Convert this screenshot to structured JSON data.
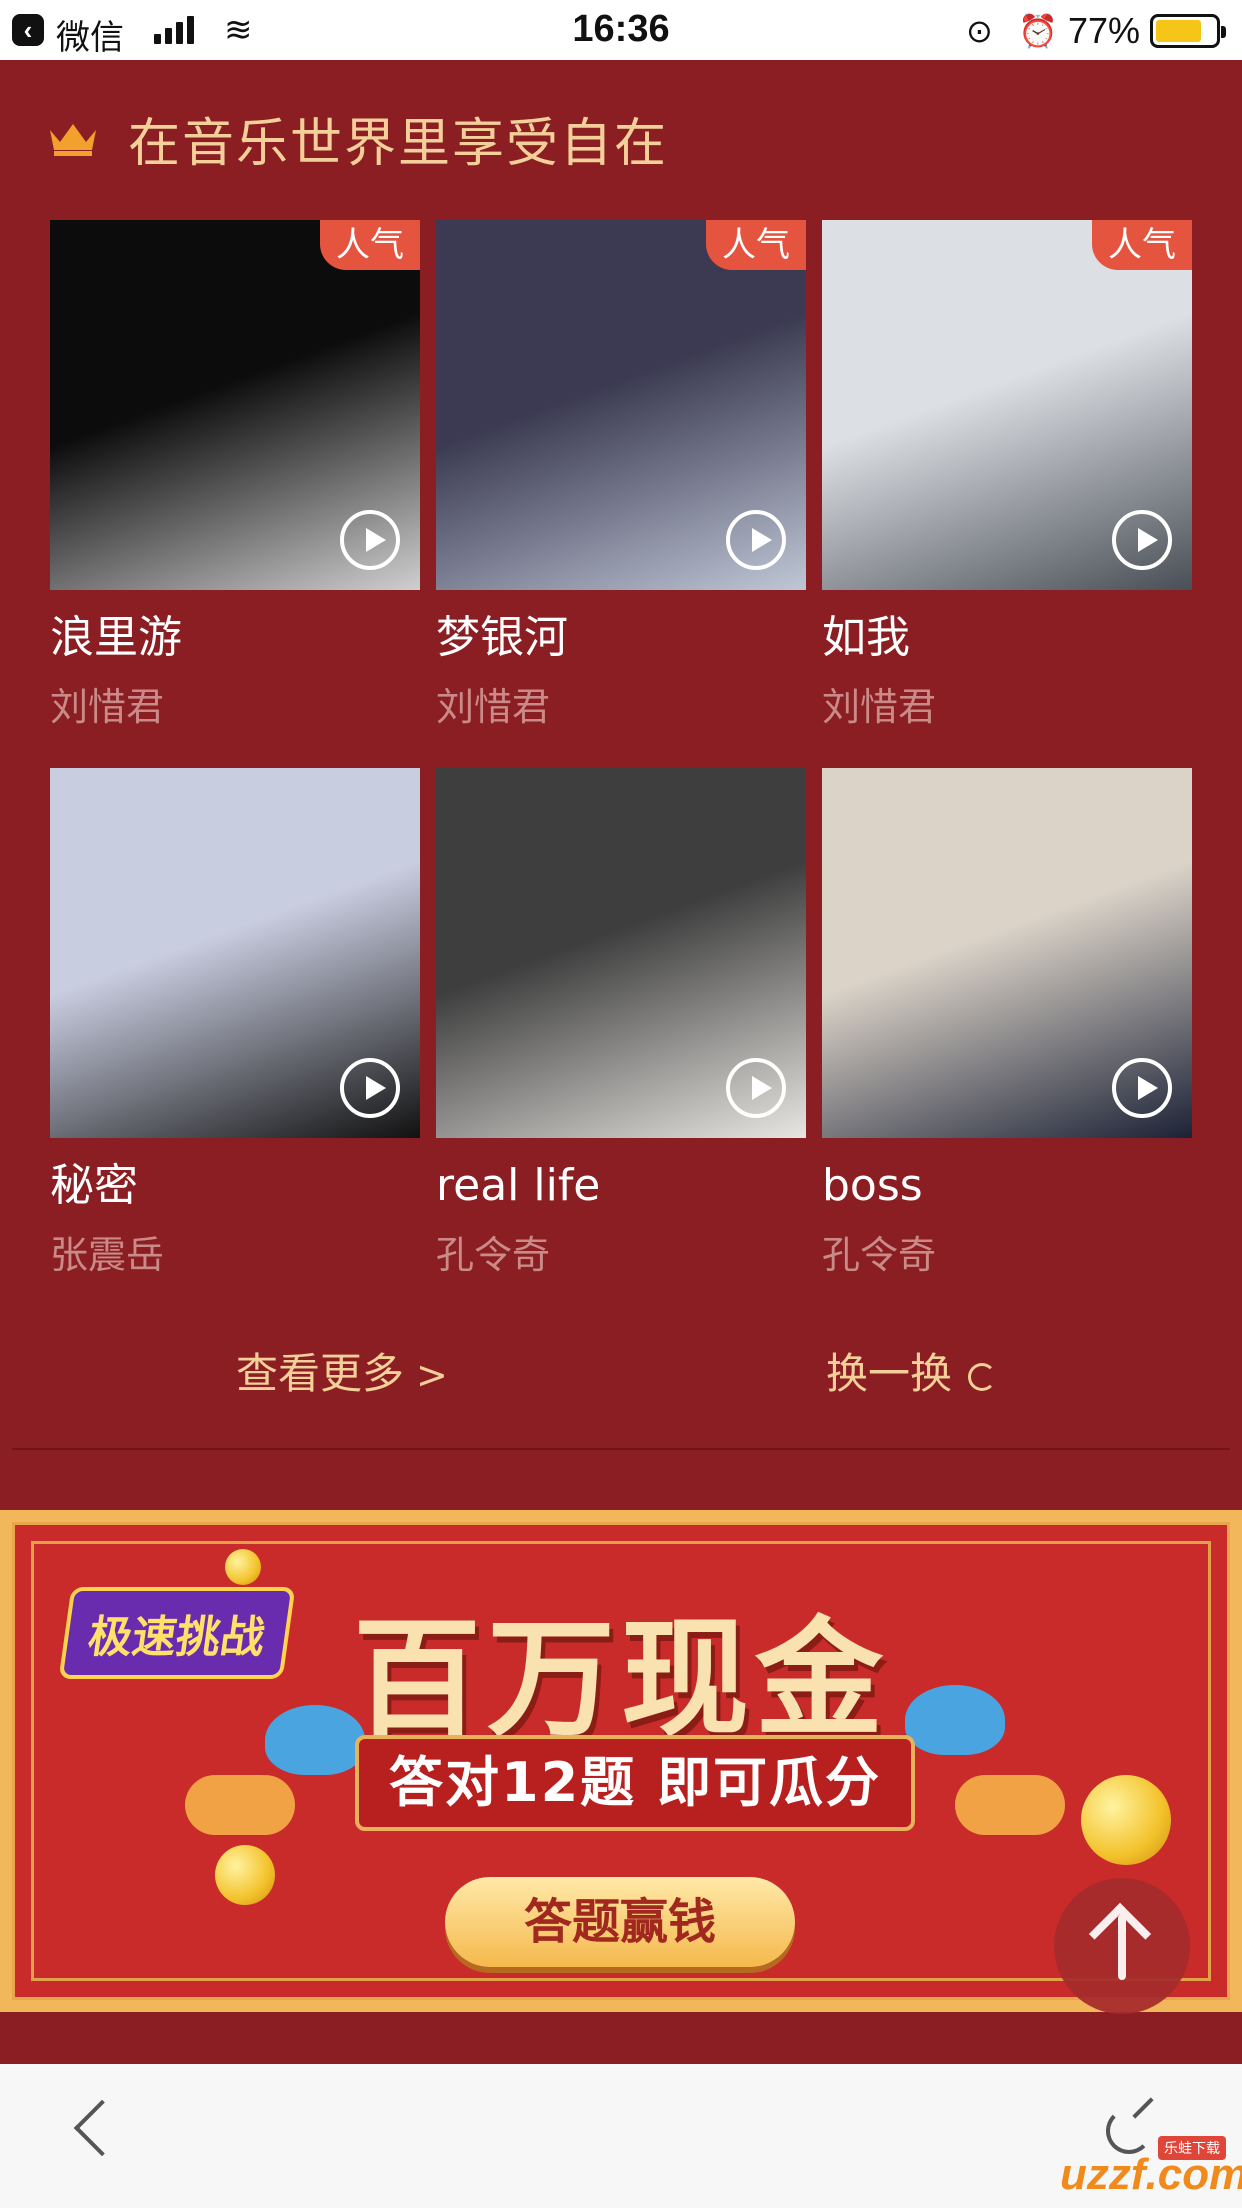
{
  "status": {
    "carrier": "微信",
    "time": "16:36",
    "battery": "77%",
    "battery_level": 0.77
  },
  "section": {
    "title": "在音乐世界里享受自在",
    "badge": "人气"
  },
  "albums": [
    {
      "title": "浪里游",
      "artist": "刘惜君",
      "popular": true,
      "cover_colors": [
        "#0c0c0c",
        "#cfcfcf"
      ]
    },
    {
      "title": "梦银河",
      "artist": "刘惜君",
      "popular": true,
      "cover_colors": [
        "#3b3a52",
        "#bfc7d6"
      ]
    },
    {
      "title": "如我",
      "artist": "刘惜君",
      "popular": true,
      "cover_colors": [
        "#dcdfe3",
        "#4a4f57"
      ]
    },
    {
      "title": "秘密",
      "artist": "张震岳",
      "popular": false,
      "cover_colors": [
        "#c9cde0",
        "#111111"
      ]
    },
    {
      "title": "real life",
      "artist": "孔令奇",
      "popular": false,
      "cover_colors": [
        "#3e3e3e",
        "#e8e6e2"
      ]
    },
    {
      "title": "boss",
      "artist": "孔令奇",
      "popular": false,
      "cover_colors": [
        "#dbd3c8",
        "#1c2236"
      ]
    }
  ],
  "actions": {
    "more": "查看更多",
    "swap": "换一换"
  },
  "banner": {
    "tag": "极速挑战",
    "headline": "百万现金",
    "ribbon": "答对12题 即可瓜分",
    "cta": "答题赢钱"
  },
  "watermark": {
    "text": "uzzf",
    "suffix": ".com",
    "badge": "乐蛙下载"
  },
  "colors": {
    "background": "#8b1e23",
    "accent_gold": "#f3cf9a",
    "artist_text": "#c98a88",
    "badge": "#e5543f"
  },
  "icons": {
    "crown": "crown-icon",
    "play": "play-icon",
    "chevron": "chevron-right-icon",
    "refresh": "refresh-icon",
    "back": "back-icon",
    "share": "share-icon",
    "scroll_top": "arrow-up-icon"
  }
}
